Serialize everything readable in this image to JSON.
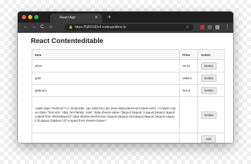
{
  "browser": {
    "tab_title": "React App",
    "tab_close": "✕",
    "new_tab": "+",
    "url": "https://5jl50183r4.codesandbox.io",
    "nav": {
      "back": "←",
      "forward": "→",
      "reload": "C",
      "home": "⌂"
    },
    "menu": "⋮"
  },
  "page": {
    "title": "React Contenteditable",
    "table": {
      "headers": {
        "item": "Item",
        "price": "Price",
        "action": "Action"
      },
      "rows": [
        {
          "item": "silver",
          "price": "15.41",
          "action": "Delete"
        },
        {
          "item": "gold",
          "price": "1966.5",
          "action": "Delete"
        },
        {
          "item": "platinum",
          "price": "924.9",
          "action": "Delete"
        },
        {
          "item": "<style type=\"text/css\"><!--td {border: 1px solid #ccc;}br {mso-data-placement:same-cell;}--></style><span style=\"font-size: 10pt; font-family: Arial;\" data-sheets-value=\"{&quot;1&quot;:2,&quot;2&quot;:&quot;copied from sheets&quot;}\" data-sheets-userformat=\"{&quot;2&quot;:513,&quot;3&quot;:{&quot;1&quot;:0},&quot;12&quot;:0}\">copied from sheets</span>",
          "price": "",
          "action": "Delete"
        }
      ],
      "add_label": "Add"
    }
  }
}
